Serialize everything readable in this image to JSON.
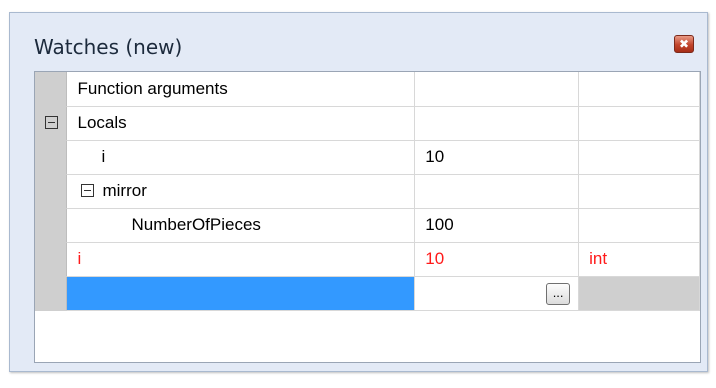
{
  "window": {
    "title": "Watches (new)",
    "close_glyph": "✖"
  },
  "grid": {
    "rows": [
      {
        "name": "Function arguments",
        "value": "",
        "type": ""
      },
      {
        "name": "Locals",
        "value": "",
        "type": ""
      },
      {
        "name": "i",
        "value": "10",
        "type": ""
      },
      {
        "name": "mirror",
        "value": "",
        "type": ""
      },
      {
        "name": "NumberOfPieces",
        "value": "100",
        "type": ""
      },
      {
        "name": "i",
        "value": "10",
        "type": "int"
      }
    ],
    "new_row": {
      "name": "",
      "value": "",
      "type": "",
      "button_label": "..."
    }
  },
  "colors": {
    "highlight": "#3399ff",
    "changed_value": "#ff1a1a",
    "gutter": "#cfcfcf",
    "frame_bg": "#e3eaf6"
  },
  "icons": {
    "expander": "collapse-minus-icon",
    "close": "close-icon"
  }
}
